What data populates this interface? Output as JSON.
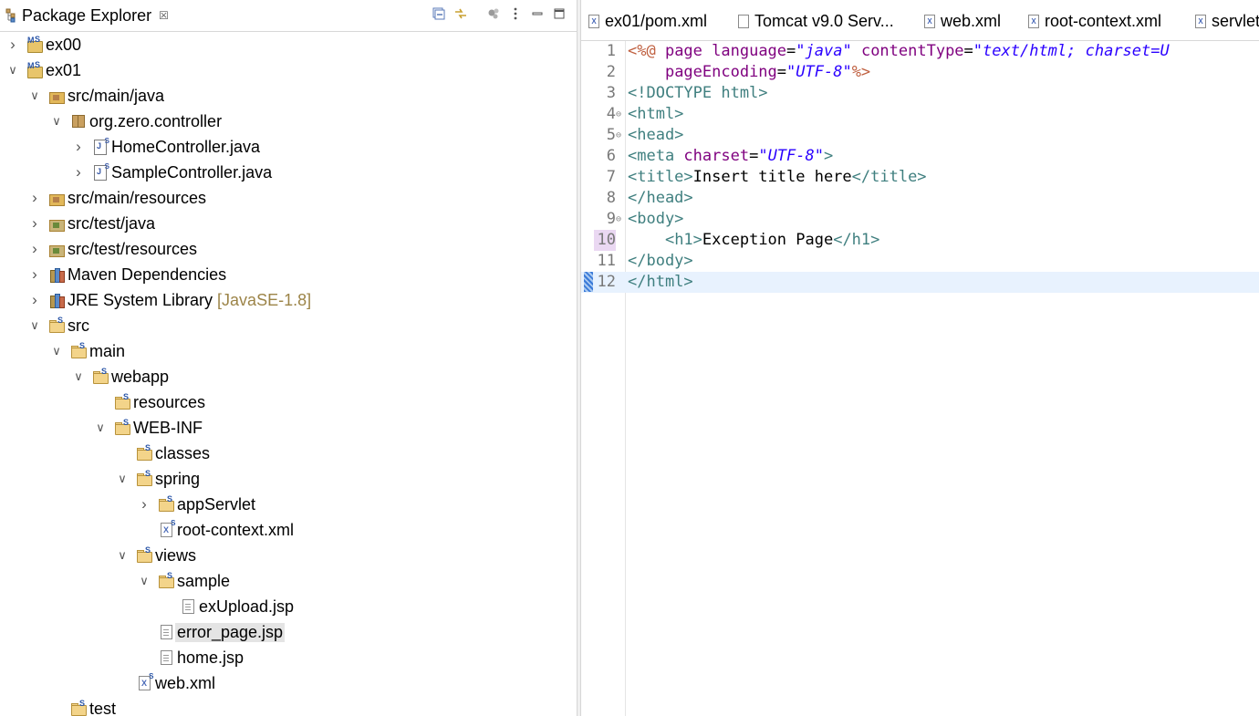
{
  "explorer": {
    "title": "Package Explorer",
    "close_glyph": "☒",
    "tree": [
      {
        "id": "ex00",
        "label": "ex00",
        "depth": 0,
        "twisty": "collapsed",
        "icon": "maven-project-icon"
      },
      {
        "id": "ex01",
        "label": "ex01",
        "depth": 0,
        "twisty": "expanded",
        "icon": "maven-project-icon"
      },
      {
        "id": "src-main-java",
        "label": "src/main/java",
        "depth": 1,
        "twisty": "expanded",
        "icon": "source-folder-icon"
      },
      {
        "id": "pkg-controller",
        "label": "org.zero.controller",
        "depth": 2,
        "twisty": "expanded",
        "icon": "package-icon"
      },
      {
        "id": "home-controller",
        "label": "HomeController.java",
        "depth": 3,
        "twisty": "collapsed",
        "icon": "java-file-icon"
      },
      {
        "id": "sample-controller",
        "label": "SampleController.java",
        "depth": 3,
        "twisty": "collapsed",
        "icon": "java-file-icon"
      },
      {
        "id": "src-main-resources",
        "label": "src/main/resources",
        "depth": 1,
        "twisty": "collapsed",
        "icon": "source-folder-icon"
      },
      {
        "id": "src-test-java",
        "label": "src/test/java",
        "depth": 1,
        "twisty": "collapsed",
        "icon": "test-source-folder-icon"
      },
      {
        "id": "src-test-resources",
        "label": "src/test/resources",
        "depth": 1,
        "twisty": "collapsed",
        "icon": "test-source-folder-icon"
      },
      {
        "id": "maven-deps",
        "label": "Maven Dependencies",
        "depth": 1,
        "twisty": "collapsed",
        "icon": "library-icon"
      },
      {
        "id": "jre-lib",
        "label": "JRE System Library",
        "decoration": "[JavaSE-1.8]",
        "depth": 1,
        "twisty": "collapsed",
        "icon": "library-icon"
      },
      {
        "id": "src",
        "label": "src",
        "depth": 1,
        "twisty": "expanded",
        "icon": "folder-icon"
      },
      {
        "id": "main",
        "label": "main",
        "depth": 2,
        "twisty": "expanded",
        "icon": "folder-icon"
      },
      {
        "id": "webapp",
        "label": "webapp",
        "depth": 3,
        "twisty": "expanded",
        "icon": "folder-icon"
      },
      {
        "id": "resources",
        "label": "resources",
        "depth": 4,
        "twisty": "none",
        "icon": "folder-icon"
      },
      {
        "id": "web-inf",
        "label": "WEB-INF",
        "depth": 4,
        "twisty": "expanded",
        "icon": "folder-icon"
      },
      {
        "id": "classes",
        "label": "classes",
        "depth": 5,
        "twisty": "none",
        "icon": "folder-icon"
      },
      {
        "id": "spring",
        "label": "spring",
        "depth": 5,
        "twisty": "expanded",
        "icon": "folder-icon"
      },
      {
        "id": "app-servlet",
        "label": "appServlet",
        "depth": 6,
        "twisty": "collapsed",
        "icon": "folder-icon"
      },
      {
        "id": "root-context",
        "label": "root-context.xml",
        "depth": 6,
        "twisty": "none",
        "icon": "xml-file-icon"
      },
      {
        "id": "views",
        "label": "views",
        "depth": 5,
        "twisty": "expanded",
        "icon": "folder-icon"
      },
      {
        "id": "sample",
        "label": "sample",
        "depth": 6,
        "twisty": "expanded",
        "icon": "folder-icon"
      },
      {
        "id": "exupload",
        "label": "exUpload.jsp",
        "depth": 7,
        "twisty": "none",
        "icon": "jsp-file-icon"
      },
      {
        "id": "error-page",
        "label": "error_page.jsp",
        "depth": 6,
        "twisty": "none",
        "icon": "jsp-file-icon",
        "selected": true
      },
      {
        "id": "home-jsp",
        "label": "home.jsp",
        "depth": 6,
        "twisty": "none",
        "icon": "jsp-file-icon"
      },
      {
        "id": "web-xml",
        "label": "web.xml",
        "depth": 5,
        "twisty": "none",
        "icon": "xml-file-icon"
      },
      {
        "id": "test",
        "label": "test",
        "depth": 2,
        "twisty": "none",
        "icon": "folder-icon"
      }
    ]
  },
  "editor": {
    "tabs": [
      {
        "label": "ex01/pom.xml",
        "icon": "xml-file-icon"
      },
      {
        "label": "Tomcat v9.0 Serv...",
        "icon": "server-config-icon"
      },
      {
        "label": "web.xml",
        "icon": "xml-file-icon"
      },
      {
        "label": "root-context.xml",
        "icon": "xml-file-icon"
      },
      {
        "label": "servlet",
        "icon": "xml-file-icon"
      }
    ],
    "lines": [
      {
        "n": "1",
        "fold": "",
        "parts": [
          [
            "c-dir",
            "<%@ "
          ],
          [
            "c-attr",
            "page "
          ],
          [
            "c-attr",
            "language"
          ],
          [
            "c-txt",
            "="
          ],
          [
            "c-val",
            "\"java\""
          ],
          [
            "c-txt",
            " "
          ],
          [
            "c-attr",
            "contentType"
          ],
          [
            "c-txt",
            "="
          ],
          [
            "c-val",
            "\"text/html; charset=U"
          ]
        ]
      },
      {
        "n": "2",
        "fold": "",
        "parts": [
          [
            "c-txt",
            "    "
          ],
          [
            "c-attr",
            "pageEncoding"
          ],
          [
            "c-txt",
            "="
          ],
          [
            "c-val",
            "\"UTF-8\""
          ],
          [
            "c-dir",
            "%>"
          ]
        ]
      },
      {
        "n": "3",
        "fold": "",
        "parts": [
          [
            "c-tag",
            "<!DOCTYPE html>"
          ]
        ]
      },
      {
        "n": "4",
        "fold": "⊖",
        "parts": [
          [
            "c-tag",
            "<html>"
          ]
        ]
      },
      {
        "n": "5",
        "fold": "⊖",
        "parts": [
          [
            "c-tag",
            "<head>"
          ]
        ]
      },
      {
        "n": "6",
        "fold": "",
        "parts": [
          [
            "c-tag",
            "<meta "
          ],
          [
            "c-attr",
            "charset"
          ],
          [
            "c-txt",
            "="
          ],
          [
            "c-val",
            "\"UTF-8\""
          ],
          [
            "c-tag",
            ">"
          ]
        ]
      },
      {
        "n": "7",
        "fold": "",
        "parts": [
          [
            "c-tag",
            "<title>"
          ],
          [
            "c-txt",
            "Insert title here"
          ],
          [
            "c-tag",
            "</title>"
          ]
        ]
      },
      {
        "n": "8",
        "fold": "",
        "parts": [
          [
            "c-tag",
            "</head>"
          ]
        ]
      },
      {
        "n": "9",
        "fold": "⊖",
        "parts": [
          [
            "c-tag",
            "<body>"
          ]
        ]
      },
      {
        "n": "10",
        "fold": "",
        "parts": [
          [
            "c-txt",
            "    "
          ],
          [
            "c-tag",
            "<h1>"
          ],
          [
            "c-txt",
            "Exception Page"
          ],
          [
            "c-tag",
            "</h1>"
          ]
        ]
      },
      {
        "n": "11",
        "fold": "",
        "parts": [
          [
            "c-tag",
            "</body>"
          ]
        ]
      },
      {
        "n": "12",
        "fold": "",
        "parts": [
          [
            "c-tag",
            "</html>"
          ]
        ]
      }
    ]
  }
}
